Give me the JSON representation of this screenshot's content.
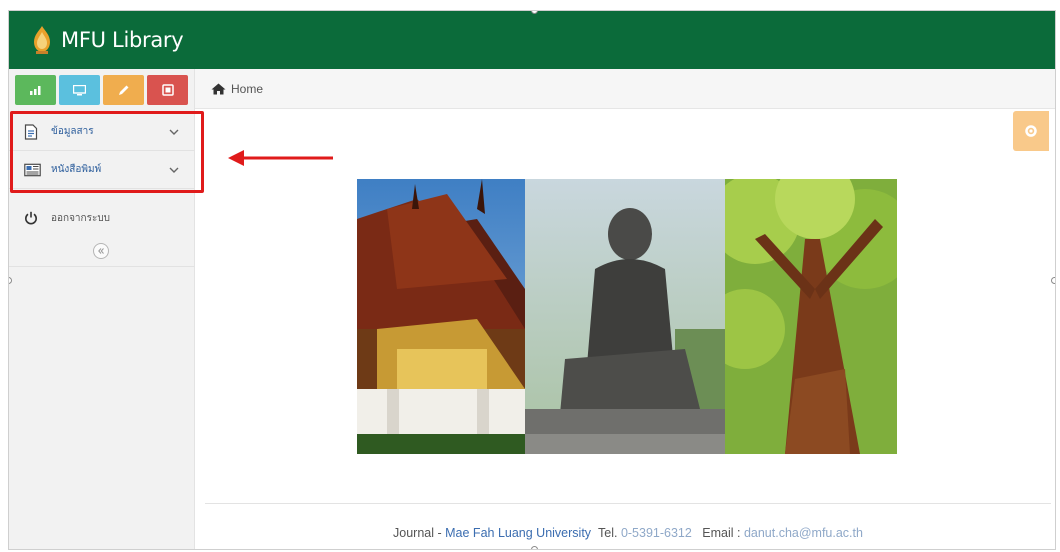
{
  "app": {
    "title": "MFU Library"
  },
  "colors": {
    "header": "#0b6b3a",
    "shortcut_green": "#5cb85c",
    "shortcut_blue": "#5bc0de",
    "shortcut_yellow": "#f0ad4e",
    "shortcut_red": "#d9534f",
    "highlight": "#e01b1b",
    "settings": "#f9c98a"
  },
  "shortcuts": [
    {
      "icon": "signal-icon",
      "color": "green"
    },
    {
      "icon": "desktop-icon",
      "color": "blue"
    },
    {
      "icon": "pencil-icon",
      "color": "yellow"
    },
    {
      "icon": "cogs-icon",
      "color": "red"
    }
  ],
  "sidebar": {
    "items": [
      {
        "label": "ข้อมูลสาร",
        "icon": "document-icon",
        "chevron": "chevron-down-icon"
      },
      {
        "label": "หนังสือพิมพ์",
        "icon": "newspaper-icon",
        "chevron": "chevron-down-icon"
      },
      {
        "label": "ออกจากระบบ",
        "icon": "power-icon"
      }
    ],
    "collapse_icon": "double-chevron-left-icon"
  },
  "breadcrumb": {
    "icon": "home-icon",
    "label": "Home"
  },
  "settings_icon": "gear-icon",
  "footer": {
    "journal": "Journal",
    "sep1": " - ",
    "university": "Mae Fah Luang University",
    "tel_label": "Tel.",
    "tel_value": "0-5391-6312",
    "email_label": "Email :",
    "email_value": "danut.cha@mfu.ac.th"
  }
}
